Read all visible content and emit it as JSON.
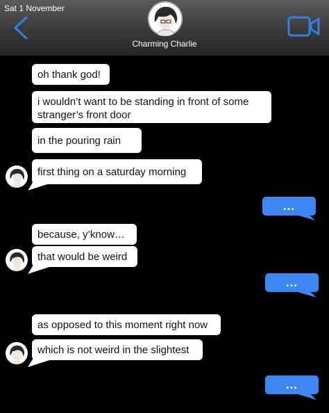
{
  "status": {
    "date": "Sat 1 November"
  },
  "header": {
    "back_icon": "chevron-left-icon",
    "video_icon": "video-camera-icon",
    "contact_name": "Charming Charlie",
    "accent_color": "#2f7fe8"
  },
  "messages": [
    {
      "sender": "them",
      "text": "oh thank god!"
    },
    {
      "sender": "them",
      "text": "i wouldn’t want to be standing in front of some stranger’s front door"
    },
    {
      "sender": "them",
      "text": "in the pouring rain"
    },
    {
      "sender": "them",
      "text": "first thing on a saturday morning"
    },
    {
      "sender": "me",
      "text": "…"
    },
    {
      "sender": "them",
      "text": "because, y’know…"
    },
    {
      "sender": "them",
      "text": "that would be weird"
    },
    {
      "sender": "me",
      "text": "…"
    },
    {
      "sender": "them",
      "text": "as opposed to this moment right now"
    },
    {
      "sender": "them",
      "text": "which is not weird in the slightest"
    },
    {
      "sender": "me",
      "text": "…"
    }
  ],
  "colors": {
    "incoming_bubble": "#ffffff",
    "outgoing_bubble": "#3d87f5",
    "background": "#000000"
  }
}
